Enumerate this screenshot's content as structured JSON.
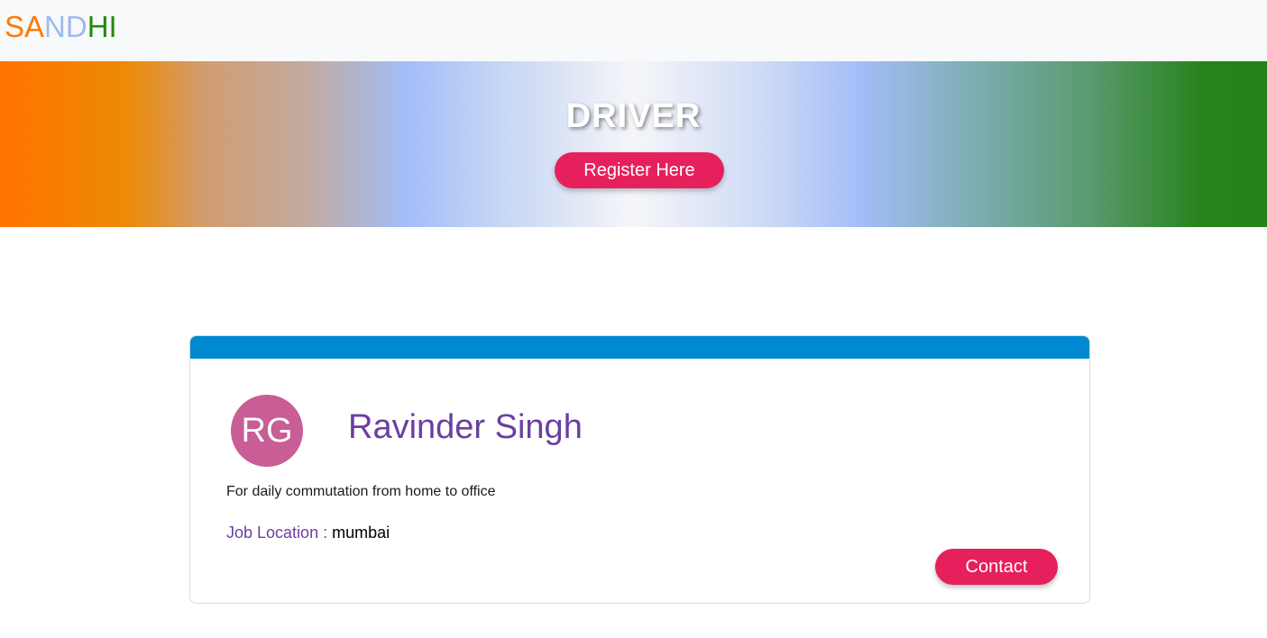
{
  "brand": {
    "part1": "SA",
    "part2": "ND",
    "part3": "HI",
    "colors": [
      "#ff7a00",
      "#9fb9ef",
      "#238a0e"
    ]
  },
  "hero": {
    "title": "DRIVER",
    "register_label": "Register Here"
  },
  "listing": {
    "accent_color": "#0089d0",
    "avatar_initials": "RG",
    "name": "Ravinder Singh",
    "description": "For daily commutation from home to office",
    "location_label": "Job Location :",
    "location_value": "mumbai",
    "contact_label": "Contact"
  }
}
